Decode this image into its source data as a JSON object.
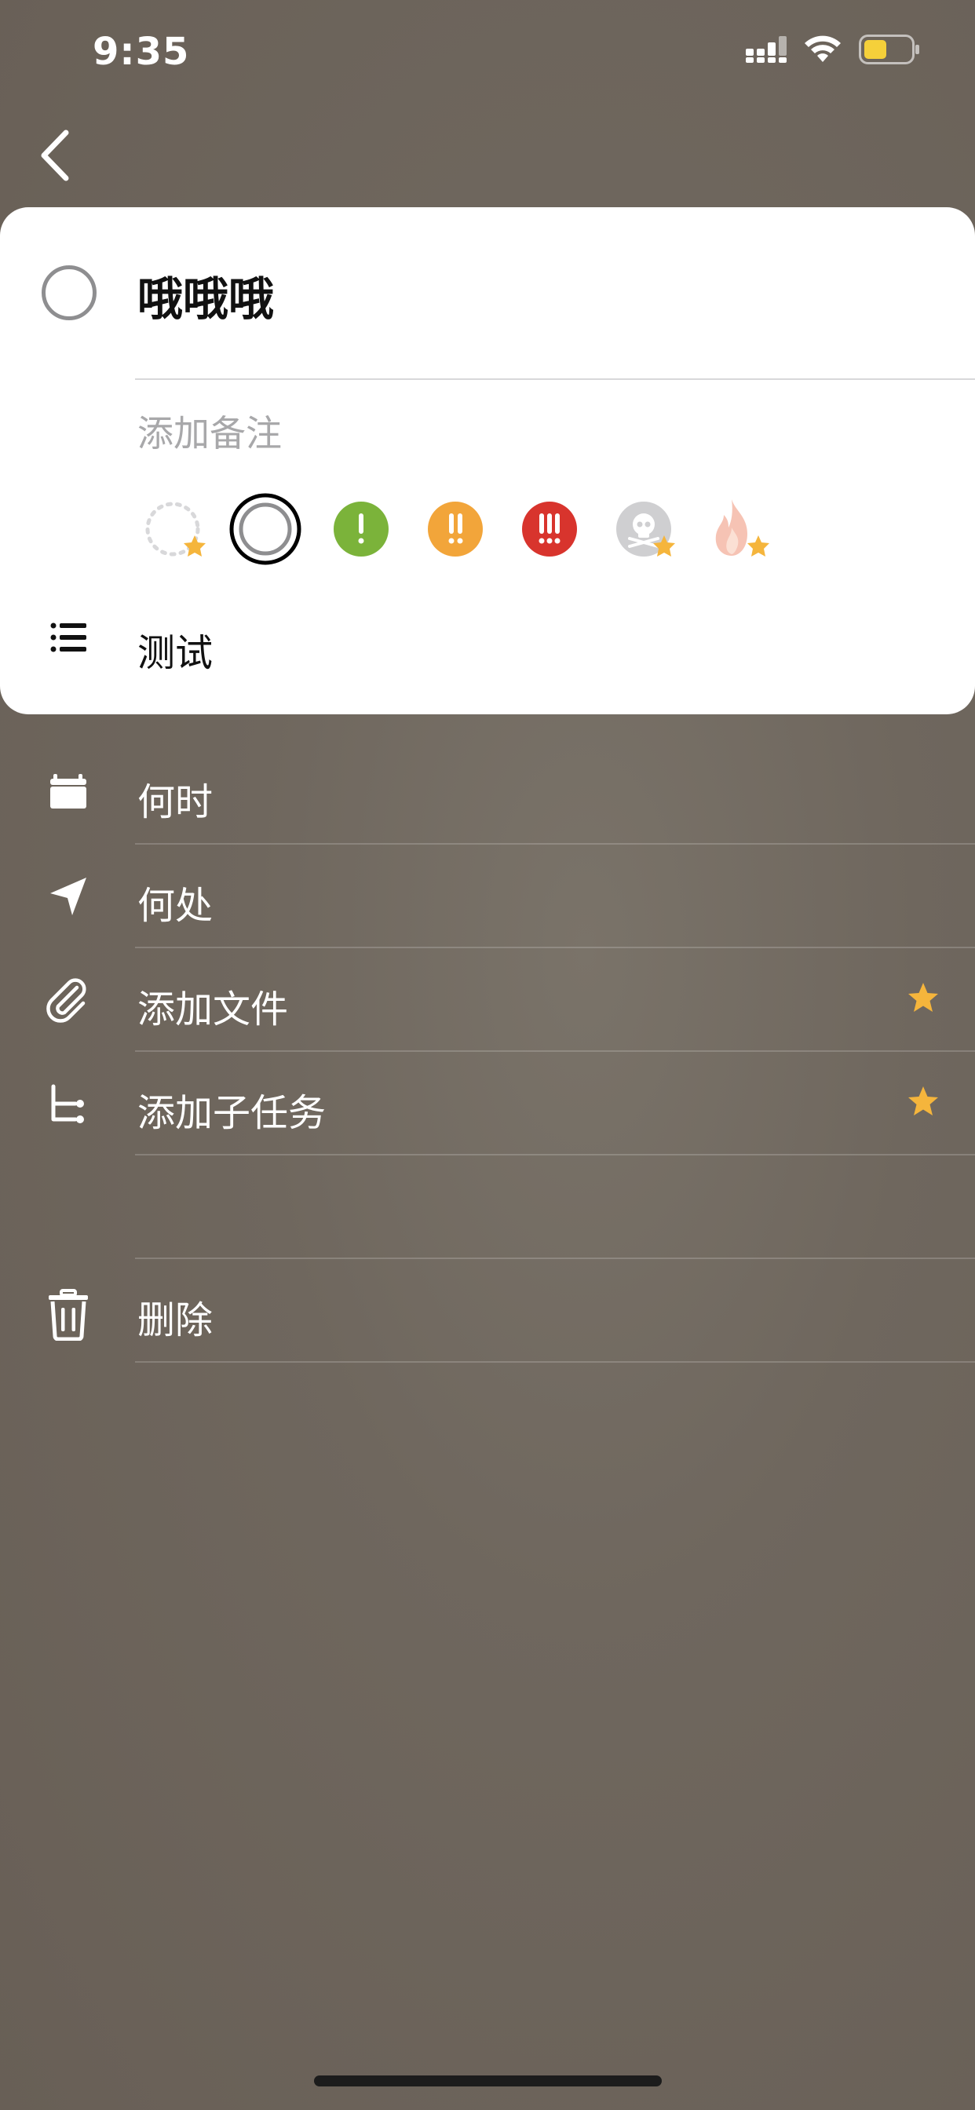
{
  "status_bar": {
    "time": "9:35",
    "signal_icon": "cellular-signal-icon",
    "wifi_icon": "wifi-icon",
    "battery_icon": "battery-icon",
    "battery_color": "#f5d03a"
  },
  "nav": {
    "back_icon": "chevron-left-icon"
  },
  "task": {
    "title": "哦哦哦",
    "note_placeholder": "添加备注",
    "list_name": "测试",
    "list_icon": "list-icon"
  },
  "priorities": [
    {
      "name": "none",
      "icon": "dotted-circle-icon",
      "premium": true
    },
    {
      "name": "default",
      "icon": "ring-icon",
      "selected": true
    },
    {
      "name": "low",
      "icon": "single-exclamation-icon",
      "color": "#7bb33a"
    },
    {
      "name": "medium",
      "icon": "double-exclamation-icon",
      "color": "#f2a53a"
    },
    {
      "name": "high",
      "icon": "triple-exclamation-icon",
      "color": "#d8342d"
    },
    {
      "name": "skull",
      "icon": "skull-icon",
      "color": "#c8c8ca",
      "premium": true
    },
    {
      "name": "fire",
      "icon": "fire-icon",
      "color": "#f4b0a0",
      "premium": true
    }
  ],
  "actions": [
    {
      "label": "何时",
      "icon": "calendar-icon"
    },
    {
      "label": "何处",
      "icon": "location-arrow-icon"
    },
    {
      "label": "添加文件",
      "icon": "paperclip-icon",
      "premium": true
    },
    {
      "label": "添加子任务",
      "icon": "subtask-icon",
      "premium": true
    }
  ],
  "delete": {
    "label": "删除",
    "icon": "trash-icon"
  },
  "colors": {
    "star": "#f5b53c",
    "background": "#6f675e"
  }
}
